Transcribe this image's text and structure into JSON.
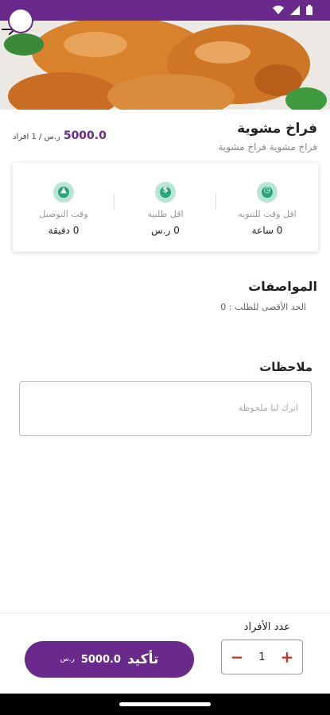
{
  "status": {
    "time": ""
  },
  "product": {
    "title": "فراخ مشوية",
    "subtitle": "فراخ مشوية فراخ مشوية",
    "price": "5000.0",
    "price_unit": "ر.س / 1 افراد"
  },
  "info": [
    {
      "icon": "clock-icon",
      "glyph": "◷",
      "label": "اقل وقت للتنويه",
      "value": "0 ساعة"
    },
    {
      "icon": "dollar-icon",
      "glyph": "$",
      "label": "اقل طلبية",
      "value": "0 ر.س"
    },
    {
      "icon": "delivery-person-icon",
      "glyph": "▲",
      "label": "وقت التوصيل",
      "value": "0 دقيقة"
    }
  ],
  "specs": {
    "title": "المواصفات",
    "max_order": "الحد الأقصى للطلب : 0"
  },
  "notes": {
    "title": "ملاحظات",
    "placeholder": "اترك لنا ملحوظة",
    "value": ""
  },
  "order": {
    "count_label": "عدد الأفراد",
    "quantity": "1",
    "minus": "−",
    "plus": "+",
    "confirm_label": "تأكيد",
    "confirm_amount": "5000.0",
    "confirm_unit": "ر.س"
  },
  "colors": {
    "primary": "#6a2a8c",
    "accent_green": "#2aa57a",
    "stepper_red": "#c0392b"
  }
}
